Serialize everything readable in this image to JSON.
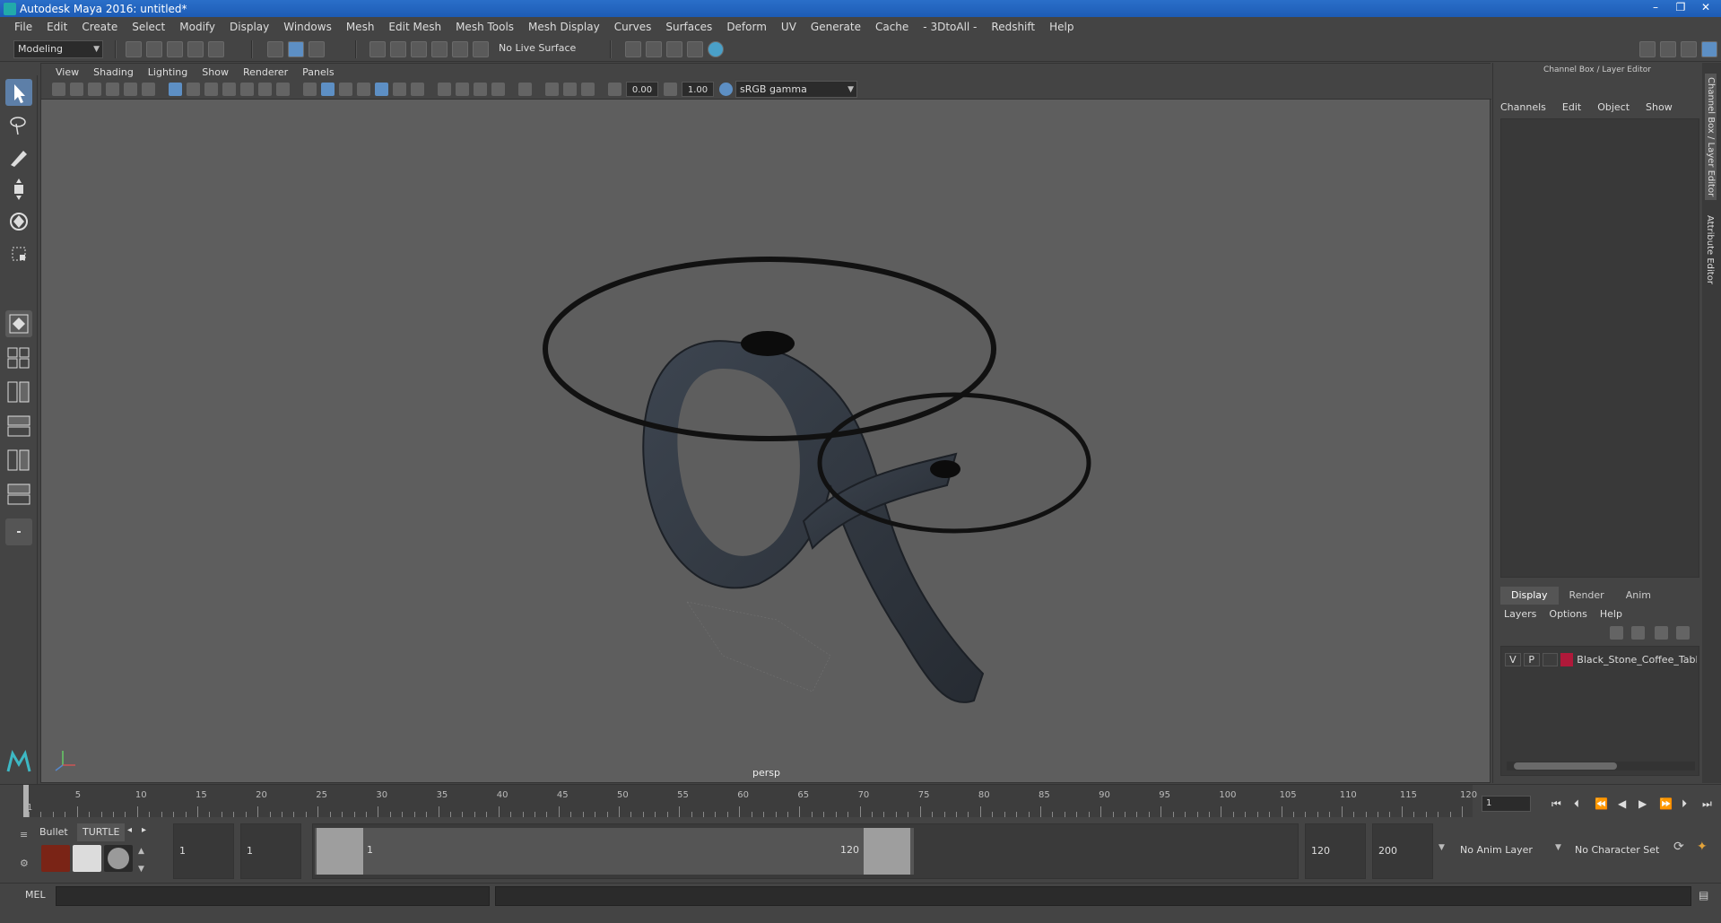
{
  "window": {
    "title": "Autodesk Maya 2016: untitled*",
    "controls": [
      "–",
      "❐",
      "✕"
    ]
  },
  "menubar": [
    "File",
    "Edit",
    "Create",
    "Select",
    "Modify",
    "Display",
    "Windows",
    "Mesh",
    "Edit Mesh",
    "Mesh Tools",
    "Mesh Display",
    "Curves",
    "Surfaces",
    "Deform",
    "UV",
    "Generate",
    "Cache",
    "- 3DtoAll -",
    "Redshift",
    "Help"
  ],
  "statusline": {
    "mode": "Modeling",
    "live_surface": "No Live Surface"
  },
  "viewport": {
    "menu": [
      "View",
      "Shading",
      "Lighting",
      "Show",
      "Renderer",
      "Panels"
    ],
    "exposure": "0.00",
    "gamma": "1.00",
    "color_space": "sRGB gamma",
    "camera_label": "persp"
  },
  "channel_box": {
    "title": "Channel Box / Layer Editor",
    "menu": [
      "Channels",
      "Edit",
      "Object",
      "Show"
    ],
    "side_tabs": [
      "Channel Box / Layer Editor",
      "Attribute Editor"
    ]
  },
  "layer_editor": {
    "tabs": [
      "Display",
      "Render",
      "Anim"
    ],
    "active_tab": "Display",
    "menu": [
      "Layers",
      "Options",
      "Help"
    ],
    "layers": [
      {
        "v": "V",
        "p": "P",
        "name": "Black_Stone_Coffee_Tabl",
        "color": "#b0193a"
      }
    ]
  },
  "timeline": {
    "ticks": [
      "1",
      "5",
      "10",
      "15",
      "20",
      "25",
      "30",
      "35",
      "40",
      "45",
      "50",
      "55",
      "60",
      "65",
      "70",
      "75",
      "80",
      "85",
      "90",
      "95",
      "100",
      "105",
      "110",
      "115",
      "120"
    ],
    "current_frame": "1"
  },
  "range": {
    "start_time": "1",
    "playback_start": "1",
    "range_start_label": "1",
    "range_end_label": "120",
    "playback_end": "120",
    "end_time": "200",
    "anim_layer": "No Anim Layer",
    "character_set": "No Character Set"
  },
  "shelf": {
    "tabs": [
      "Bullet",
      "TURTLE"
    ]
  },
  "cmdline": {
    "label": "MEL"
  }
}
